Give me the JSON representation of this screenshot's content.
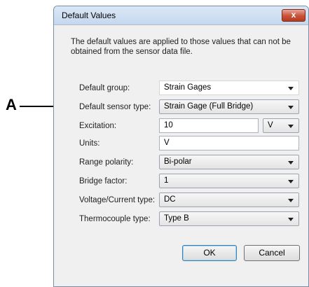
{
  "callout": {
    "letter": "A"
  },
  "dialog": {
    "title": "Default Values",
    "close_label": "x",
    "description": "The default values are applied to those values that can not be obtained from the sensor data file.",
    "fields": {
      "default_group": {
        "label": "Default group:",
        "value": "Strain Gages"
      },
      "default_sensor_type": {
        "label": "Default sensor type:",
        "value": "Strain Gage (Full Bridge)"
      },
      "excitation": {
        "label": "Excitation:",
        "value": "10",
        "unit": "V"
      },
      "units": {
        "label": "Units:",
        "value": "V"
      },
      "range_polarity": {
        "label": "Range polarity:",
        "value": "Bi-polar"
      },
      "bridge_factor": {
        "label": "Bridge factor:",
        "value": "1"
      },
      "voltage_current_type": {
        "label": "Voltage/Current type:",
        "value": "DC"
      },
      "thermocouple_type": {
        "label": "Thermocouple type:",
        "value": "Type B"
      }
    },
    "buttons": {
      "ok": "OK",
      "cancel": "Cancel"
    }
  }
}
